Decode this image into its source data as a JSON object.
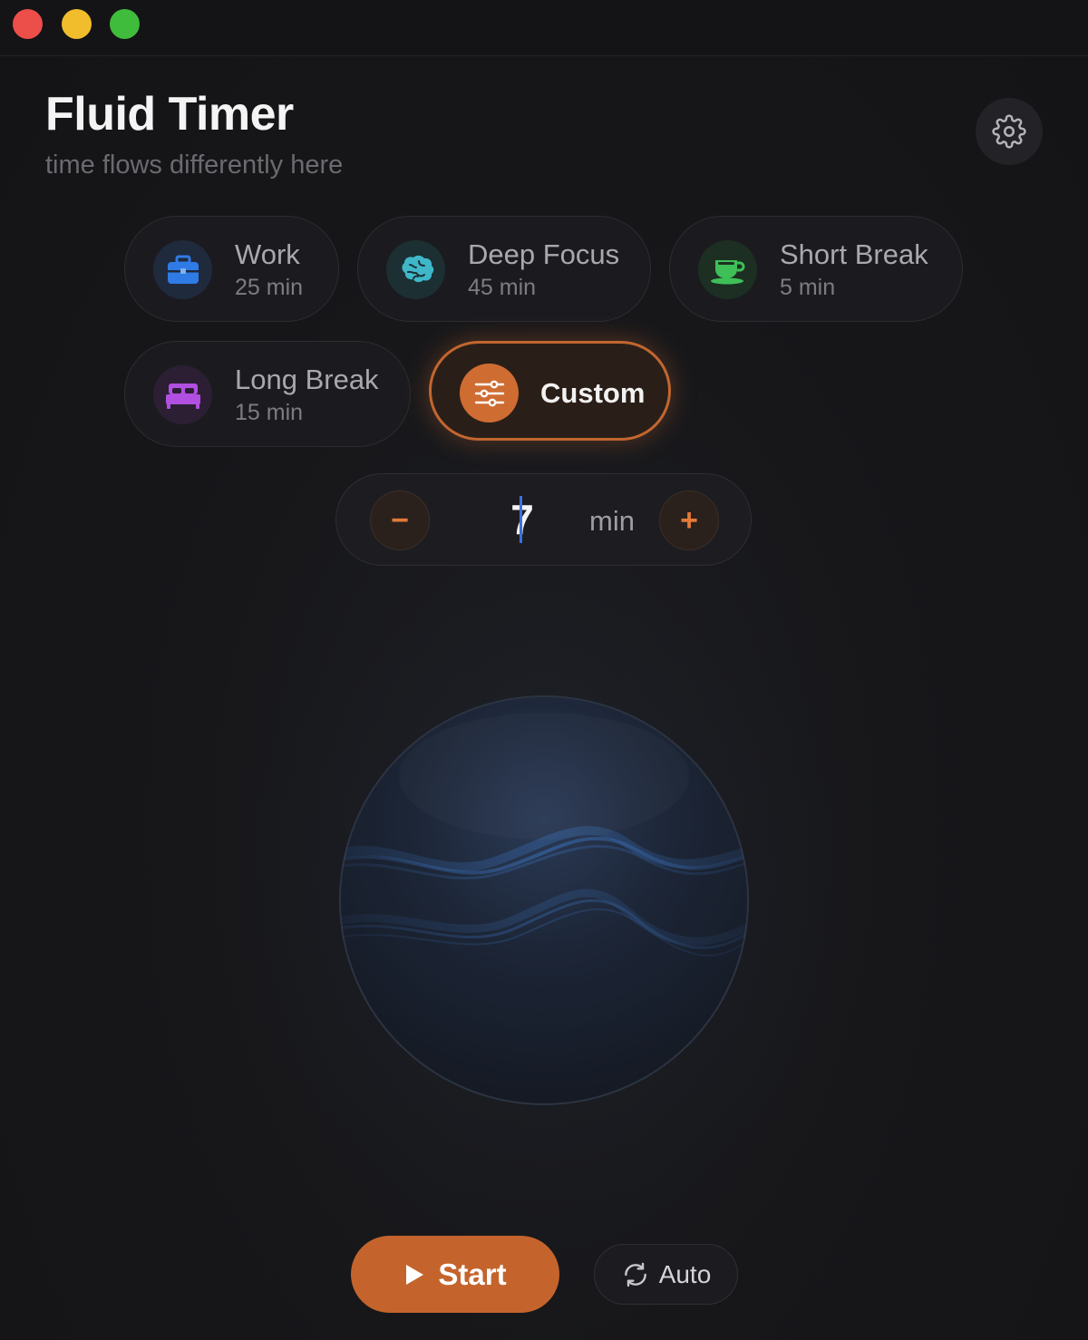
{
  "window": {
    "controls": [
      "close",
      "minimize",
      "zoom"
    ]
  },
  "header": {
    "title": "Fluid Timer",
    "subtitle": "time flows differently here",
    "settings_icon": "gear-icon"
  },
  "presets": [
    {
      "id": "work",
      "name": "Work",
      "duration": "25 min",
      "icon": "briefcase-icon",
      "color": "#2f7be6",
      "icon_bg": "#1f2a3d"
    },
    {
      "id": "deep-focus",
      "name": "Deep Focus",
      "duration": "45 min",
      "icon": "brain-icon",
      "color": "#3fb7c9",
      "icon_bg": "#1c2f33"
    },
    {
      "id": "short-break",
      "name": "Short Break",
      "duration": "5 min",
      "icon": "coffee-cup-icon",
      "color": "#3fbf58",
      "icon_bg": "#1c2f22"
    },
    {
      "id": "long-break",
      "name": "Long Break",
      "duration": "15 min",
      "icon": "bed-icon",
      "color": "#b04fe0",
      "icon_bg": "#2c1f33"
    },
    {
      "id": "custom",
      "name": "Custom",
      "duration": "",
      "icon": "sliders-icon",
      "color": "#cf6c32",
      "selected": true
    }
  ],
  "stepper": {
    "value": "7",
    "unit": "min",
    "decrement_label": "−",
    "increment_label": "+"
  },
  "orb": {
    "wave_color": "#3a6fb8"
  },
  "controls": {
    "start_label": "Start",
    "auto_label": "Auto"
  },
  "colors": {
    "accent": "#c4642c",
    "background": "#161619"
  }
}
